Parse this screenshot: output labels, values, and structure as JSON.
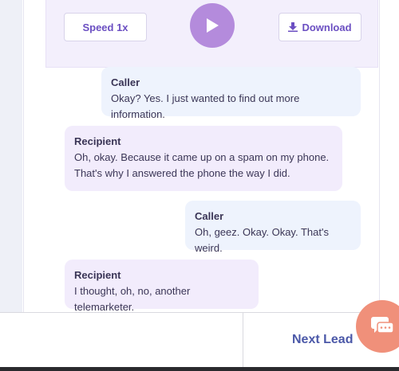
{
  "player": {
    "speed_label": "Speed 1x",
    "download_label": "Download",
    "accent": "#b48bdc"
  },
  "transcript": [
    {
      "speaker": "Caller",
      "text": "Okay? Yes. I just wanted to find out more information."
    },
    {
      "speaker": "Recipient",
      "text_lines": [
        "Oh, okay. Because it came up on a spam on my phone.",
        "That's why I answered the phone the way I did."
      ]
    },
    {
      "speaker": "Caller",
      "text": "Oh, geez. Okay. Okay. That's weird."
    },
    {
      "speaker": "Recipient",
      "text": "I thought, oh, no, another telemarketer."
    }
  ],
  "footer": {
    "next_lead_label": "Next Lead"
  },
  "icons": {
    "play": "play-icon",
    "download": "download-icon",
    "chat": "chat-icon"
  }
}
